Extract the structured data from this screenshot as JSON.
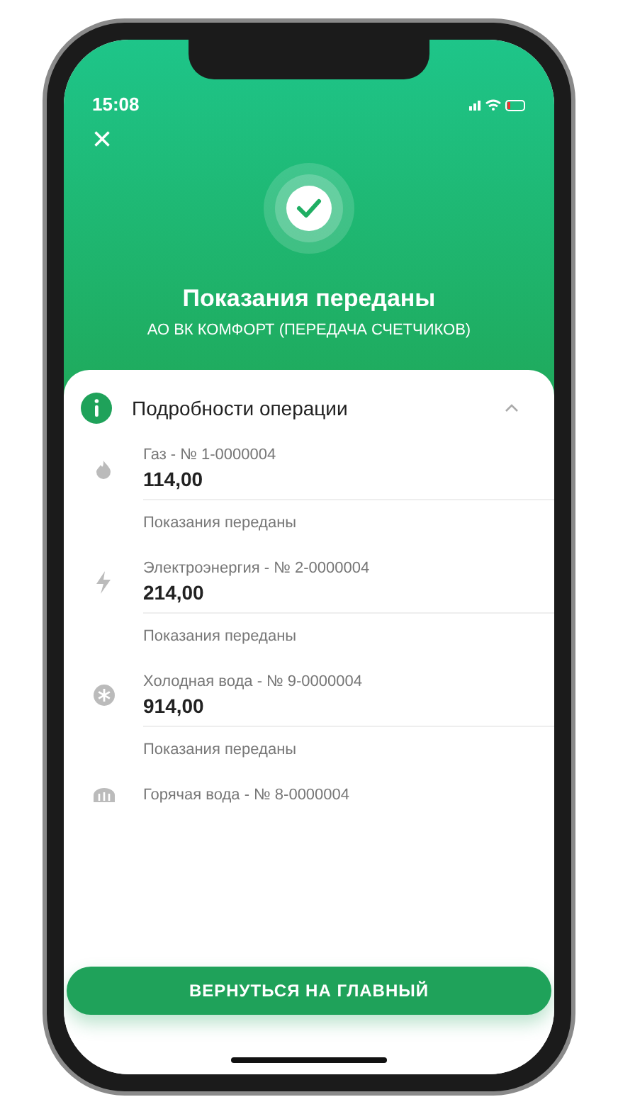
{
  "status_bar": {
    "time": "15:08"
  },
  "header": {
    "close": "×",
    "title": "Показания переданы",
    "subtitle": "АО ВК КОМФОРТ (ПЕРЕДАЧА СЧЕТЧИКОВ)"
  },
  "details": {
    "title": "Подробности операции",
    "expanded": true,
    "items": [
      {
        "kind": "gas",
        "name": "Газ - № 1-0000004",
        "value": "114,00",
        "status": "Показания переданы"
      },
      {
        "kind": "power",
        "name": "Электроэнергия - № 2-0000004",
        "value": "214,00",
        "status": "Показания переданы"
      },
      {
        "kind": "cold",
        "name": "Холодная вода - № 9-0000004",
        "value": "914,00",
        "status": "Показания переданы"
      },
      {
        "kind": "hot",
        "name": "Горячая вода - № 8-0000004"
      }
    ]
  },
  "button": "ВЕРНУТЬСЯ НА ГЛАВНЫЙ"
}
